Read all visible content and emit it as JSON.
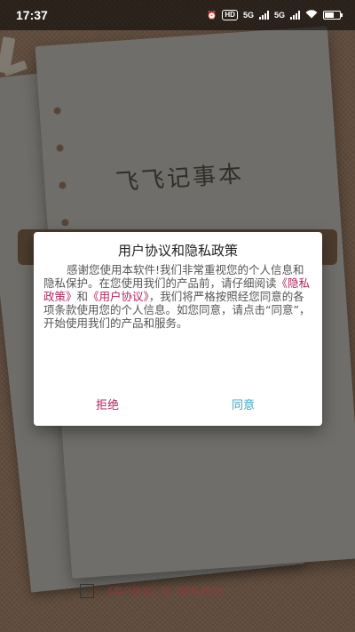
{
  "status_bar": {
    "time": "17:37",
    "hd_badge": "HD",
    "net1": "5G",
    "net2": "5G"
  },
  "background": {
    "app_title": "飞飞记事本",
    "agreement_text": "《用户协议》和《隐私政策》"
  },
  "dialog": {
    "title": "用户协议和隐私政策",
    "body_intro": "感谢您使用本软件!我们非常重视您的个人信息和隐私保护。在您使用我们的产品前，请仔细阅读",
    "privacy_link": "《隐私政策》",
    "and": "和",
    "user_link": "《用户协议》",
    "body_rest": "，我们将严格按照经您同意的各项条款使用您的个人信息。如您同意，请点击“同意”，开始使用我们的产品和服务。",
    "reject_label": "拒绝",
    "agree_label": "同意"
  },
  "colors": {
    "accent_link": "#b3245e",
    "agree_button": "#3aa9c8",
    "wood_background": "#b08a6e"
  }
}
